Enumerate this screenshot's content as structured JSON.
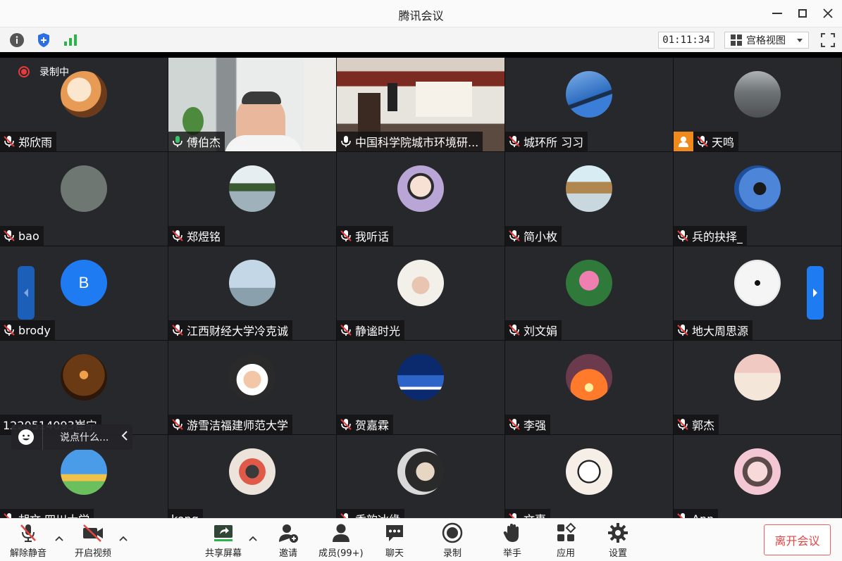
{
  "window": {
    "title": "腾讯会议"
  },
  "infobar": {
    "timer": "01:11:34",
    "view_label": "宫格视图"
  },
  "recording": {
    "label": "录制中"
  },
  "chat": {
    "placeholder": "说点什么..."
  },
  "colors": {
    "accent_blue": "#1f7bf2",
    "tile_bg": "#27282c",
    "leave_red": "#e34545",
    "active_green": "#37c76b",
    "record_red": "#e83a3a"
  },
  "participants": [
    {
      "name": "郑欣雨",
      "muted": true
    },
    {
      "name": "傅伯杰",
      "muted": false,
      "video": true,
      "active": true
    },
    {
      "name": "中国科学院城市环境研...",
      "muted": false,
      "video": true
    },
    {
      "name": "城环所 习习",
      "muted": true
    },
    {
      "name": "天鸣",
      "muted": true,
      "badge": true
    },
    {
      "name": "bao",
      "muted": true
    },
    {
      "name": "郑煜铭",
      "muted": true
    },
    {
      "name": "我听话",
      "muted": true
    },
    {
      "name": "简小枚",
      "muted": true
    },
    {
      "name": "兵的抉择_",
      "muted": true
    },
    {
      "name": "brody",
      "muted": true,
      "initial": "B"
    },
    {
      "name": "江西财经大学冷克诚",
      "muted": true
    },
    {
      "name": "静谧时光",
      "muted": true
    },
    {
      "name": "刘文娟",
      "muted": true
    },
    {
      "name": "地大周思源",
      "muted": true
    },
    {
      "name": "1220514093崔宁",
      "muted": true,
      "nomic": true
    },
    {
      "name": "游雪洁福建师范大学",
      "muted": true
    },
    {
      "name": "贺嘉霖",
      "muted": true
    },
    {
      "name": "李强",
      "muted": true
    },
    {
      "name": "郭杰",
      "muted": true
    },
    {
      "name": "胡文 四川大学",
      "muted": true
    },
    {
      "name": "kong",
      "muted": false,
      "nomic": true
    },
    {
      "name": "香韵冰缘",
      "muted": true
    },
    {
      "name": "文事",
      "muted": true
    },
    {
      "name": "Ann",
      "muted": true
    }
  ],
  "toolbar": {
    "unmute": "解除静音",
    "start_video": "开启视频",
    "share": "共享屏幕",
    "invite": "邀请",
    "members": "成员(99+)",
    "chat": "聊天",
    "record": "录制",
    "raise_hand": "举手",
    "apps": "应用",
    "settings": "设置",
    "leave": "离开会议"
  },
  "icons": [
    "info-icon",
    "shield-icon",
    "signal-icon",
    "grid-icon",
    "fullscreen-icon",
    "mic-muted-icon",
    "video-off-icon",
    "share-screen-icon",
    "invite-icon",
    "members-icon",
    "chat-icon",
    "record-icon",
    "hand-icon",
    "apps-icon",
    "settings-icon"
  ]
}
